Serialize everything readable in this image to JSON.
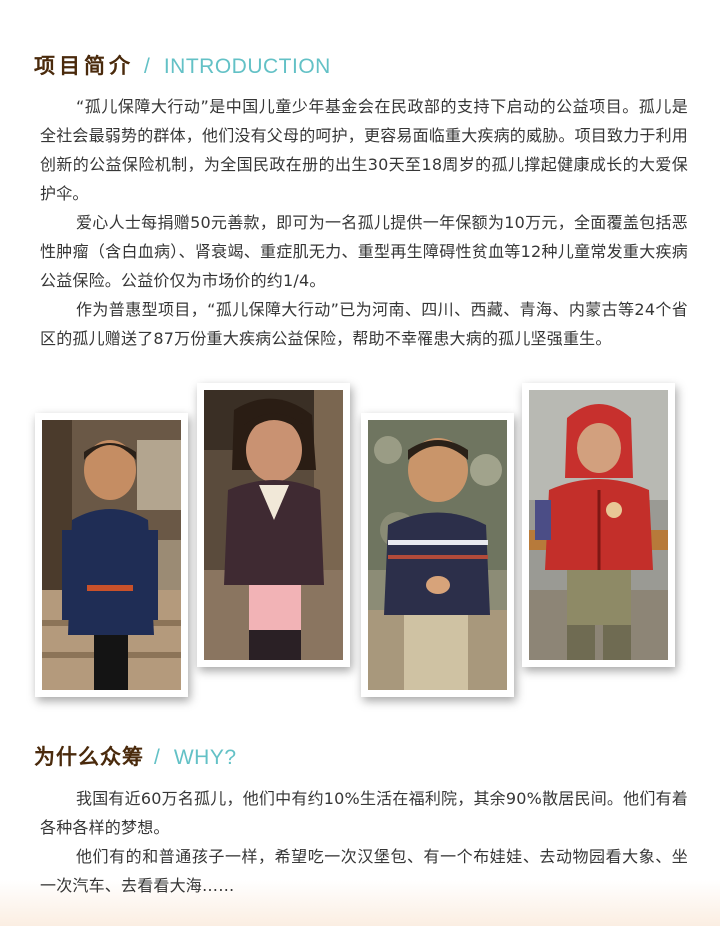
{
  "intro": {
    "title_zh": "项目简介",
    "slash": "/",
    "title_en": "INTRODUCTION",
    "paragraphs": [
      "“孤儿保障大行动”是中国儿童少年基金会在民政部的支持下启动的公益项目。孤儿是全社会最弱势的群体，他们没有父母的呵护，更容易面临重大疾病的威胁。项目致力于利用创新的公益保险机制，为全国民政在册的出生30天至18周岁的孤儿撑起健康成长的大爱保护伞。",
      "爱心人士每捐赠50元善款，即可为一名孤儿提供一年保额为10万元，全面覆盖包括恶性肿瘤（含白血病）、肾衰竭、重症肌无力、重型再生障碍性贫血等12种儿童常发重大疾病公益保险。公益价仅为市场价的约1/4。",
      "作为普惠型项目，“孤儿保障大行动”已为河南、四川、西藏、青海、内蒙古等24个省区的孤儿赠送了87万份重大疾病公益保险，帮助不幸罹患大病的孤儿坚强重生。"
    ]
  },
  "why": {
    "title_zh": "为什么众筹",
    "slash": "/",
    "title_en": "WHY?",
    "paragraphs": [
      "我国有近60万名孤儿，他们中有约10%生活在福利院，其余90%散居民间。他们有着各种各样的梦想。",
      "他们有的和普通孩子一样，希望吃一次汉堡包、有一个布娃娃、去动物园看大象、坐一次汽车、去看看大海……"
    ]
  },
  "colors": {
    "title_brown": "#4a2a0c",
    "accent_teal": "#63c1c6",
    "body_text": "#363636"
  }
}
